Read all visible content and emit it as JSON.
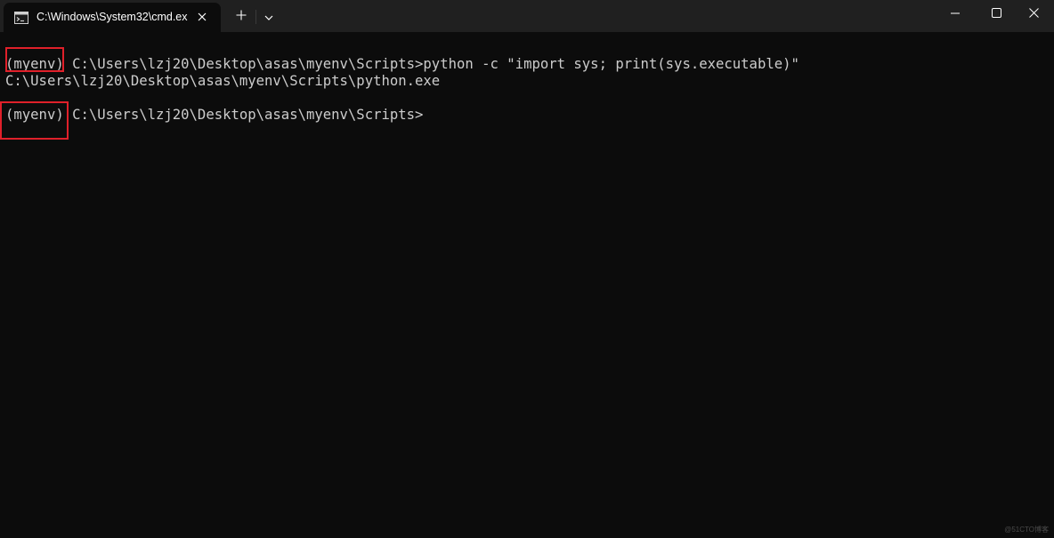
{
  "titlebar": {
    "tab_title": "C:\\Windows\\System32\\cmd.ex",
    "tab_icon": "command-prompt-icon",
    "tab_close_icon": "close-icon",
    "new_tab_icon": "plus-icon",
    "dropdown_icon": "chevron-down-icon",
    "window_controls": {
      "minimize_icon": "minimize-icon",
      "maximize_icon": "maximize-icon",
      "close_icon": "close-icon"
    }
  },
  "terminal": {
    "lines": [
      "(myenv) C:\\Users\\lzj20\\Desktop\\asas\\myenv\\Scripts>python -c \"import sys; print(sys.executable)\"",
      "C:\\Users\\lzj20\\Desktop\\asas\\myenv\\Scripts\\python.exe",
      "(myenv) C:\\Users\\lzj20\\Desktop\\asas\\myenv\\Scripts>"
    ]
  },
  "watermark": "@51CTO博客",
  "colors": {
    "background": "#0c0c0c",
    "titlebar": "#202020",
    "text": "#cccccc",
    "highlight": "#e0202a"
  }
}
